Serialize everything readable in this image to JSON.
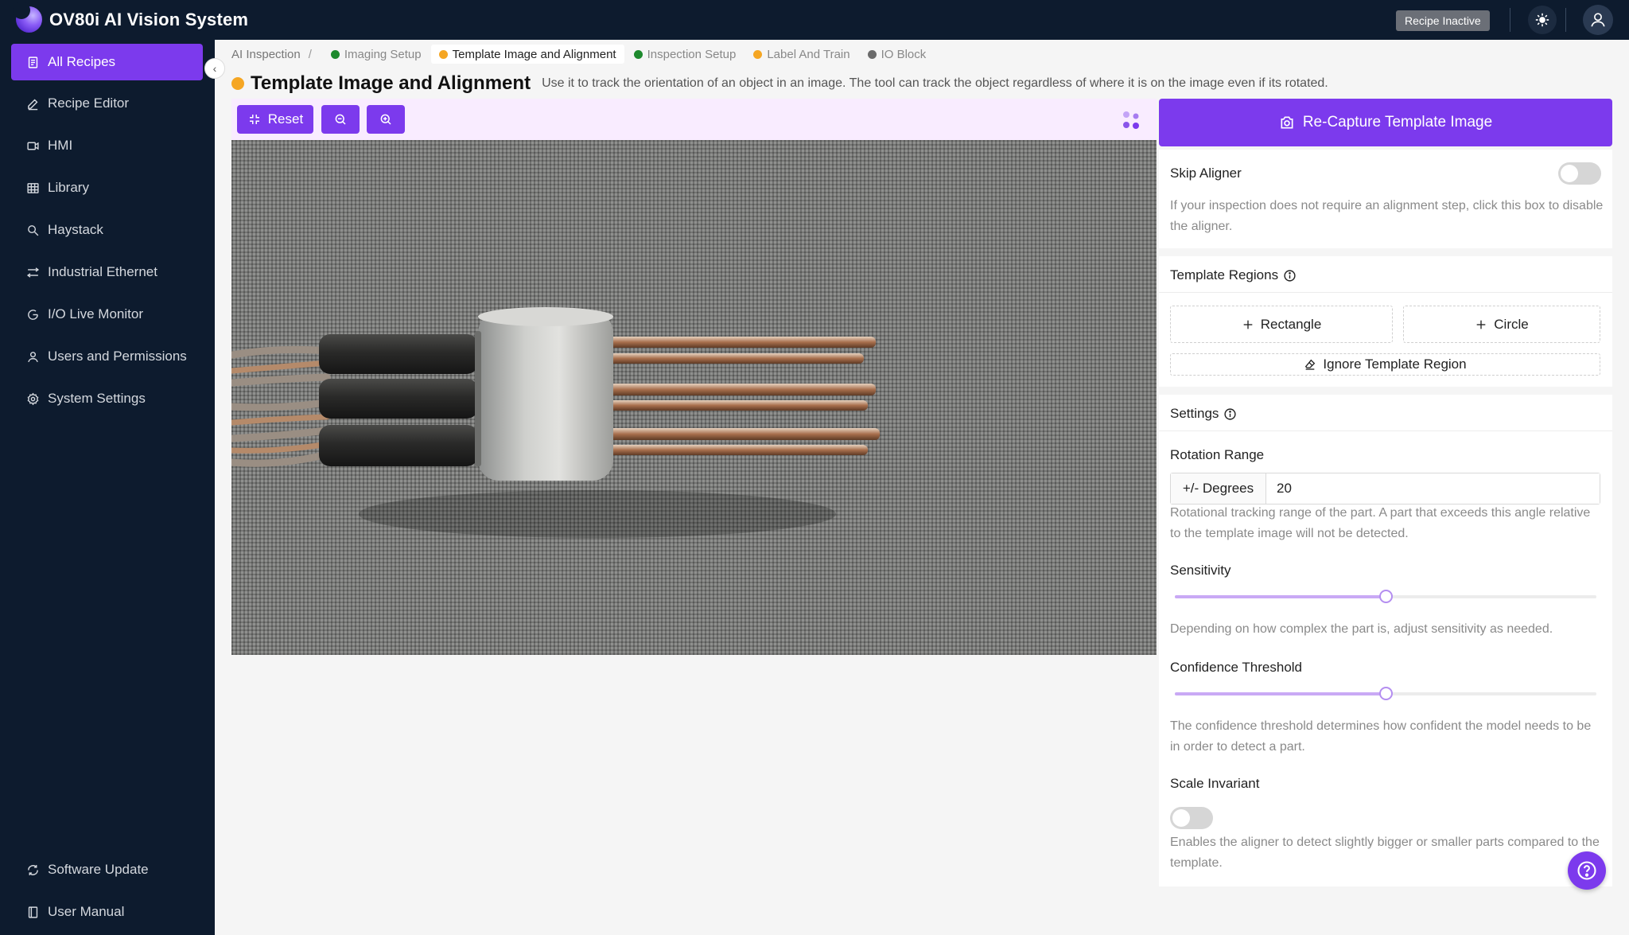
{
  "app": {
    "title": "OV80i AI Vision System",
    "recipe_status": "Recipe Inactive",
    "accent_color": "#7c3aed"
  },
  "sidebar": {
    "items": [
      {
        "label": "All Recipes",
        "icon": "document-icon",
        "active": true
      },
      {
        "label": "Recipe Editor",
        "icon": "pencil-icon"
      },
      {
        "label": "HMI",
        "icon": "video-icon"
      },
      {
        "label": "Library",
        "icon": "grid-icon"
      },
      {
        "label": "Haystack",
        "icon": "search-icon"
      },
      {
        "label": "Industrial Ethernet",
        "icon": "network-icon"
      },
      {
        "label": "I/O Live Monitor",
        "icon": "monitor-icon"
      },
      {
        "label": "Users and Permissions",
        "icon": "user-icon"
      },
      {
        "label": "System Settings",
        "icon": "gear-icon"
      }
    ],
    "bottom_items": [
      {
        "label": "Software Update",
        "icon": "refresh-icon"
      },
      {
        "label": "User Manual",
        "icon": "book-icon"
      }
    ]
  },
  "breadcrumb": {
    "root": "AI Inspection",
    "separator": "/",
    "steps": [
      {
        "label": "Imaging Setup",
        "status_color": "#1e8a2e"
      },
      {
        "label": "Template Image and Alignment",
        "status_color": "#f5a623",
        "current": true
      },
      {
        "label": "Inspection Setup",
        "status_color": "#1e8a2e"
      },
      {
        "label": "Label And Train",
        "status_color": "#f5a623"
      },
      {
        "label": "IO Block",
        "status_color": "#6b6b6b"
      }
    ]
  },
  "page": {
    "title": "Template Image and Alignment",
    "description": "Use it to track the orientation of an object in an image. The tool can track the object regardless of where it is on the image even if its rotated."
  },
  "toolbar": {
    "reset_label": "Reset"
  },
  "panel": {
    "recapture_label": "Re-Capture Template Image",
    "skip_aligner": {
      "label": "Skip Aligner",
      "enabled": false,
      "help": "If your inspection does not require an alignment step, click this box to disable the aligner."
    },
    "template_regions": {
      "title": "Template Regions",
      "rectangle_label": "Rectangle",
      "circle_label": "Circle",
      "ignore_label": "Ignore Template Region"
    },
    "settings": {
      "title": "Settings",
      "rotation_range": {
        "label": "Rotation Range",
        "unit": "+/- Degrees",
        "value": "20",
        "help": "Rotational tracking range of the part. A part that exceeds this angle relative to the template image will not be detected."
      },
      "sensitivity": {
        "label": "Sensitivity",
        "level": 0.5,
        "help": "Depending on how complex the part is, adjust sensitivity as needed."
      },
      "confidence_threshold": {
        "label": "Confidence Threshold",
        "level": 0.5,
        "help": "The confidence threshold determines how confident the model needs to be in order to detect a part."
      },
      "scale_invariant": {
        "label": "Scale Invariant",
        "enabled": false,
        "help": "Enables the aligner to detect slightly bigger or smaller parts compared to the template."
      }
    }
  }
}
